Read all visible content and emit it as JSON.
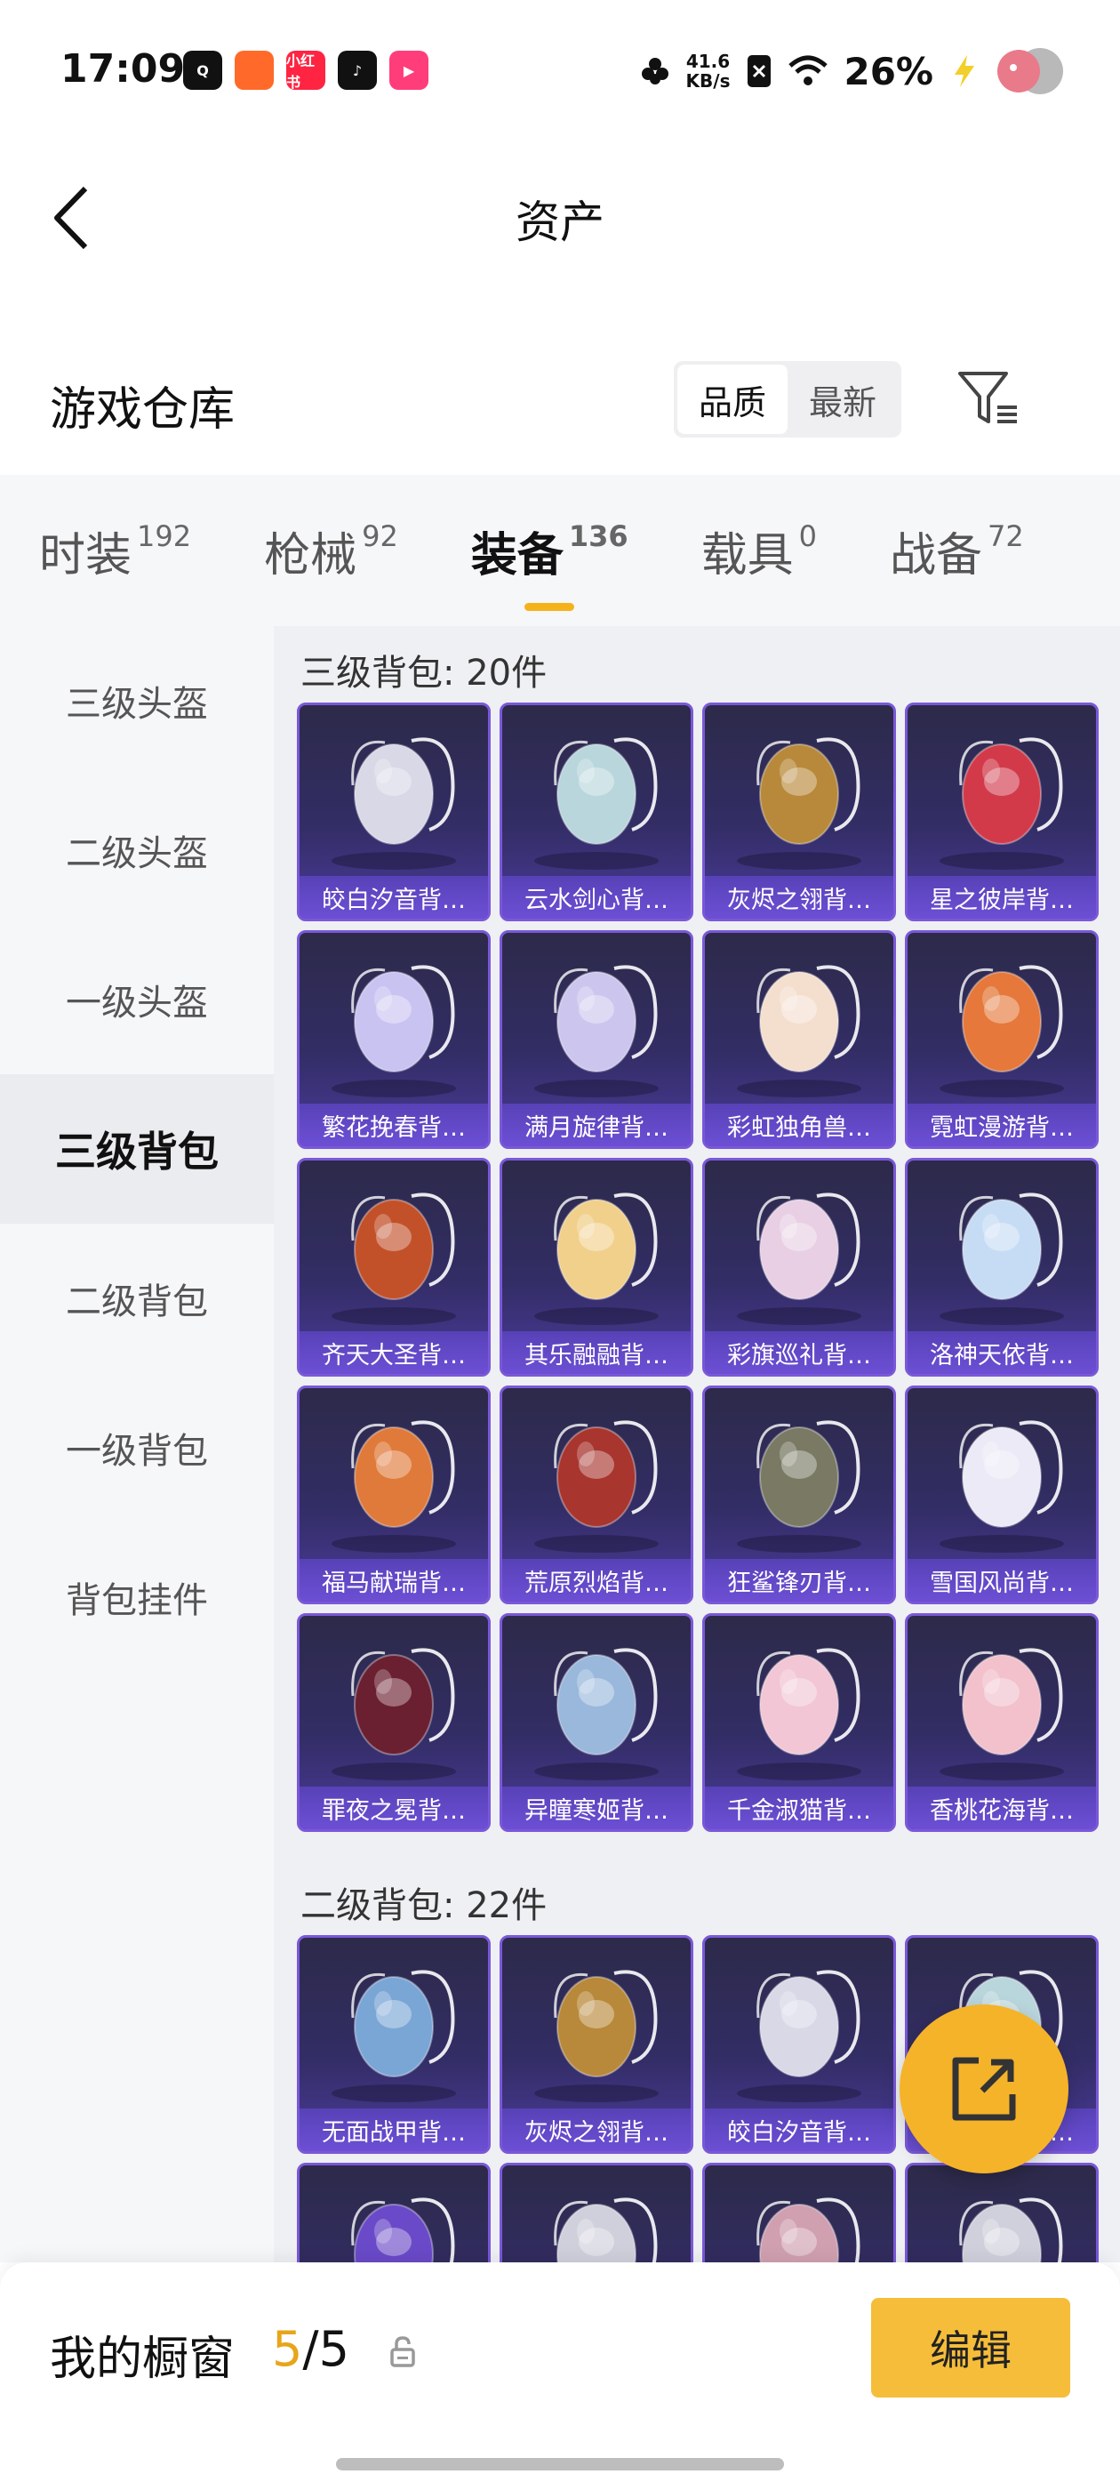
{
  "status_bar": {
    "time": "17:09",
    "speed_value": "41.6",
    "speed_unit": "KB/s",
    "battery": "26%",
    "app_icons": [
      {
        "name": "q-app-icon",
        "color": "#111111",
        "text": "Q"
      },
      {
        "name": "kuaishou-icon",
        "color": "#ff6a2a",
        "text": ""
      },
      {
        "name": "xiaohongshu-icon",
        "color": "#ff2442",
        "text": "小红书"
      },
      {
        "name": "tiktok-icon",
        "color": "#111111",
        "text": "♪"
      },
      {
        "name": "video-app-icon",
        "color": "#ff3d7a",
        "text": "▶"
      }
    ]
  },
  "header": {
    "title": "资产"
  },
  "warehouse": {
    "title": "游戏仓库",
    "sort_options": [
      "品质",
      "最新"
    ]
  },
  "tabs": [
    {
      "label": "时装",
      "count": "192"
    },
    {
      "label": "枪械",
      "count": "92"
    },
    {
      "label": "装备",
      "count": "136",
      "active": true
    },
    {
      "label": "载具",
      "count": "0"
    },
    {
      "label": "战备",
      "count": "72"
    }
  ],
  "sidenav": [
    "三级头盔",
    "二级头盔",
    "一级头盔",
    "三级背包",
    "二级背包",
    "一级背包",
    "背包挂件"
  ],
  "sections": [
    {
      "title": "三级背包: 20件",
      "items": [
        {
          "label": "皎白汐音背…",
          "icon": "pearl-backpack",
          "color": "#d8d8e6"
        },
        {
          "label": "云水剑心背…",
          "icon": "sword-backpack",
          "color": "#b9d6dc"
        },
        {
          "label": "灰烬之翎背…",
          "icon": "clock-backpack",
          "color": "#b8893a"
        },
        {
          "label": "星之彼岸背…",
          "icon": "helmet-backpack",
          "color": "#d23a4a"
        },
        {
          "label": "繁花挽春背…",
          "icon": "flower-backpack",
          "color": "#c9c3f2"
        },
        {
          "label": "满月旋律背…",
          "icon": "moon-backpack",
          "color": "#ccc6ee"
        },
        {
          "label": "彩虹独角兽…",
          "icon": "unicorn-backpack",
          "color": "#f4dfcf"
        },
        {
          "label": "霓虹漫游背…",
          "icon": "neon-backpack",
          "color": "#e5783a"
        },
        {
          "label": "齐天大圣背…",
          "icon": "monkey-king-backpack",
          "color": "#c2512a"
        },
        {
          "label": "其乐融融背…",
          "icon": "bun-backpack",
          "color": "#f1d08c"
        },
        {
          "label": "彩旗巡礼背…",
          "icon": "flag-backpack",
          "color": "#e8cfe4"
        },
        {
          "label": "洛神天依背…",
          "icon": "goddess-backpack",
          "color": "#c6dcf4"
        },
        {
          "label": "福马献瑞背…",
          "icon": "horse-backpack",
          "color": "#e07a3a"
        },
        {
          "label": "荒原烈焰背…",
          "icon": "flame-backpack",
          "color": "#a8352e"
        },
        {
          "label": "狂鲨锋刃背…",
          "icon": "shark-backpack",
          "color": "#7a7a64"
        },
        {
          "label": "雪国风尚背…",
          "icon": "penguin-backpack",
          "color": "#eceaf6"
        },
        {
          "label": "罪夜之冕背…",
          "icon": "throne-backpack",
          "color": "#6a2030"
        },
        {
          "label": "异瞳寒姬背…",
          "icon": "bunny-backpack",
          "color": "#9ab8dc"
        },
        {
          "label": "千金淑猫背…",
          "icon": "cat-backpack",
          "color": "#f2c6d4"
        },
        {
          "label": "香桃花海背…",
          "icon": "dress-backpack",
          "color": "#f2c1cc"
        }
      ]
    },
    {
      "title": "二级背包: 22件",
      "items": [
        {
          "label": "无面战甲背…",
          "icon": "armor-backpack",
          "color": "#7aa6d6"
        },
        {
          "label": "灰烬之翎背…",
          "icon": "clock-backpack",
          "color": "#b8893a"
        },
        {
          "label": "皎白汐音背…",
          "icon": "pearl-backpack",
          "color": "#d8d8e6"
        },
        {
          "label": "云水剑心背…",
          "icon": "sword-backpack",
          "color": "#b9d6dc"
        },
        {
          "label": "",
          "icon": "orb-backpack",
          "color": "#6a4ac8"
        },
        {
          "label": "",
          "icon": "strap-backpack",
          "color": "#d0d0dc"
        },
        {
          "label": "",
          "icon": "strap-backpack",
          "color": "#d0a0b0"
        },
        {
          "label": "",
          "icon": "strap-backpack",
          "color": "#d0d0dc"
        }
      ]
    }
  ],
  "bottom_bar": {
    "label": "我的橱窗",
    "used": "5",
    "sep": "/",
    "total": "5",
    "edit": "编辑"
  },
  "colors": {
    "accent": "#f5b21a",
    "card_border": "#7a58d8",
    "card_bg": "#322d64"
  }
}
